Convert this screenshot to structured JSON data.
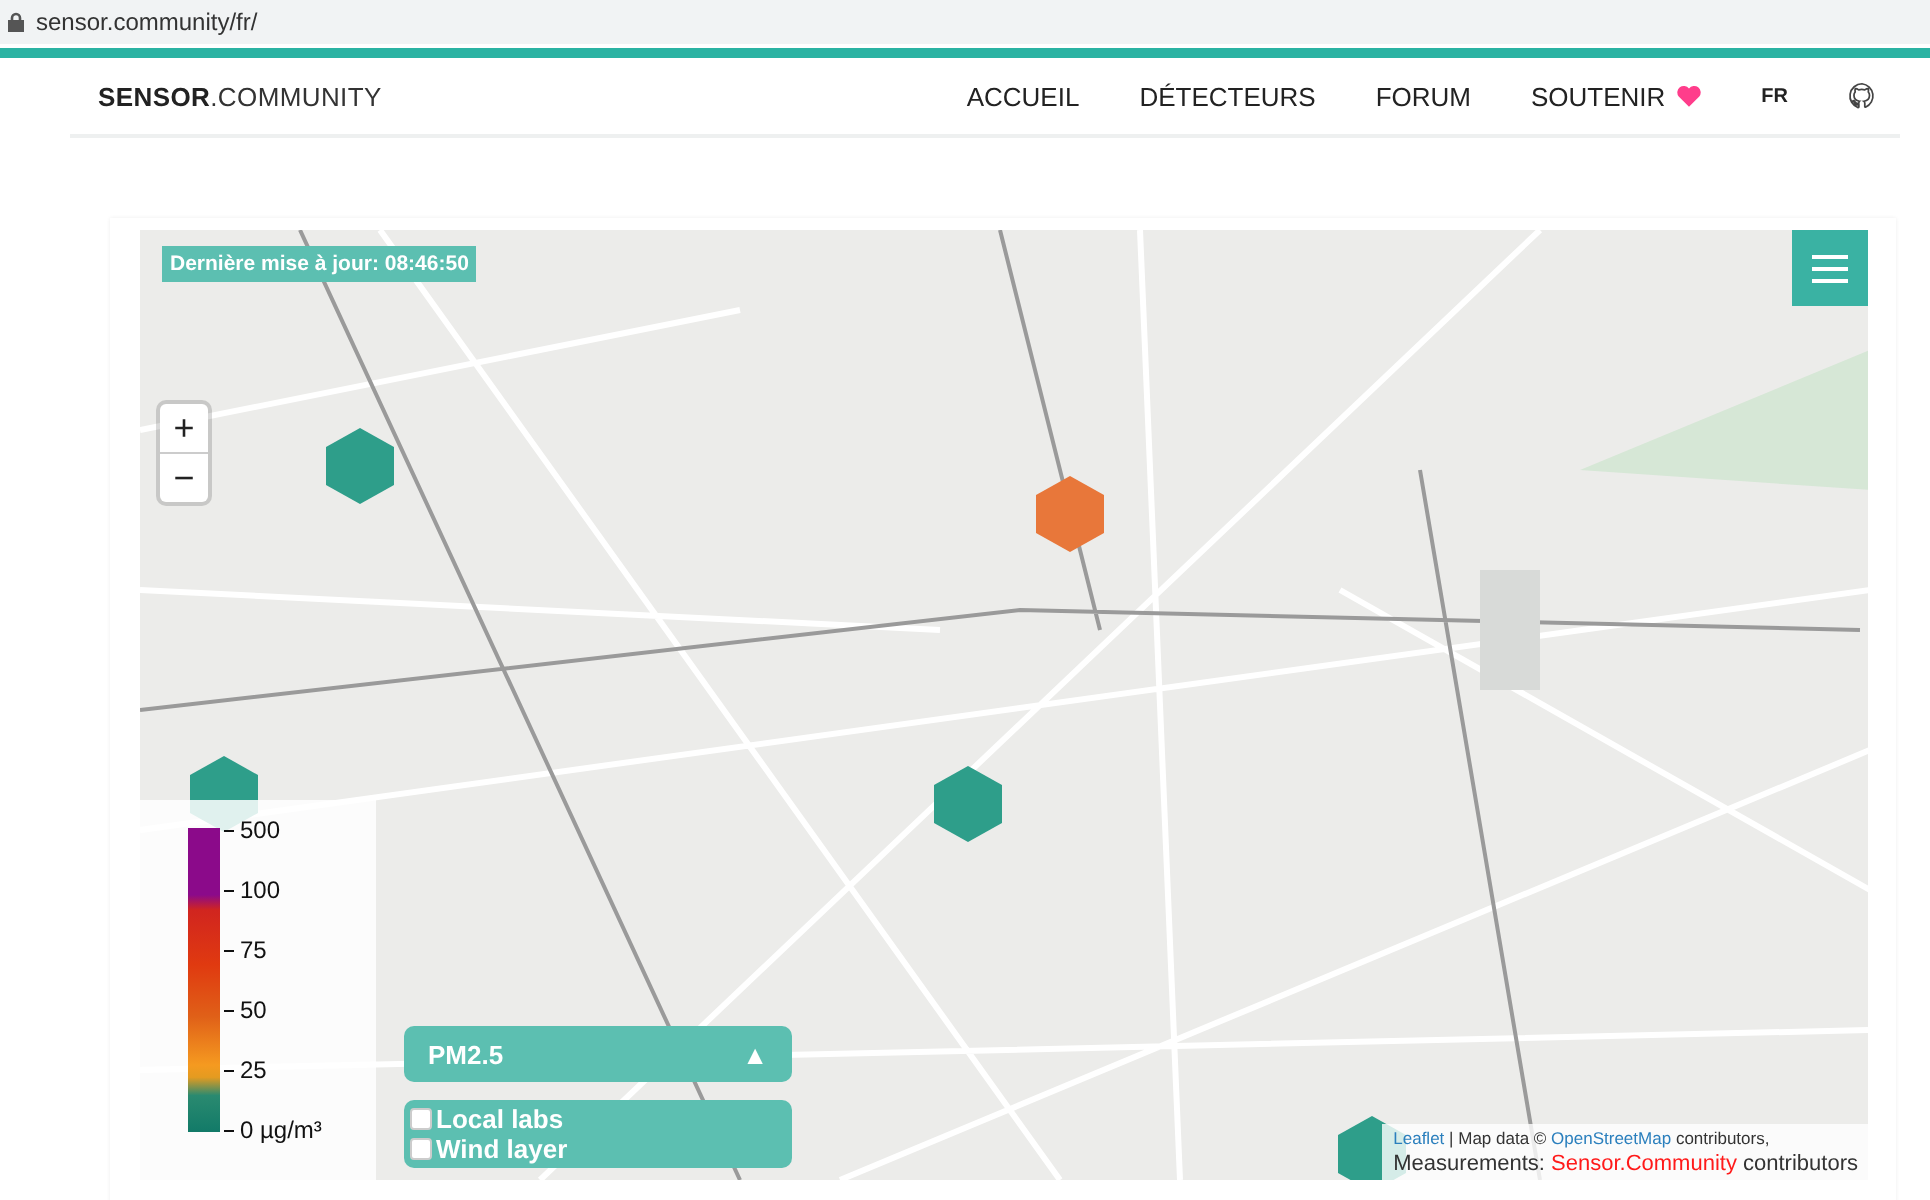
{
  "browser": {
    "url": "sensor.community/fr/"
  },
  "header": {
    "logo_bold": "SENSOR",
    "logo_rest": ".COMMUNITY",
    "nav": [
      {
        "label": "ACCUEIL"
      },
      {
        "label": "DÉTECTEURS"
      },
      {
        "label": "FORUM"
      },
      {
        "label": "SOUTENIR"
      }
    ],
    "language": "FR"
  },
  "map": {
    "last_update": "Dernière mise à jour: 08:46:50",
    "zoom_in": "+",
    "zoom_out": "−",
    "sensors": [
      {
        "color": "#2e9e8a"
      },
      {
        "color": "#e8773a"
      },
      {
        "color": "#2e9e8a"
      },
      {
        "color": "#2e9e8a"
      },
      {
        "color": "#2e9e8a"
      }
    ],
    "legend": {
      "ticks": [
        "500",
        "100",
        "75",
        "50",
        "25",
        "0 µg/m³"
      ]
    },
    "pollutant": {
      "label": "PM2.5",
      "toggle": "▲",
      "expanded": true
    },
    "layers": [
      {
        "label": "Local labs",
        "checked": false
      },
      {
        "label": "Wind layer",
        "checked": false
      }
    ],
    "attribution": {
      "leaflet": "Leaflet",
      "map_data": "| Map data © ",
      "osm": "OpenStreetMap",
      "contributors": "contributors,",
      "measurements": "Measurements: ",
      "sc": "Sensor.Community",
      "contributors2": "contributors"
    }
  }
}
